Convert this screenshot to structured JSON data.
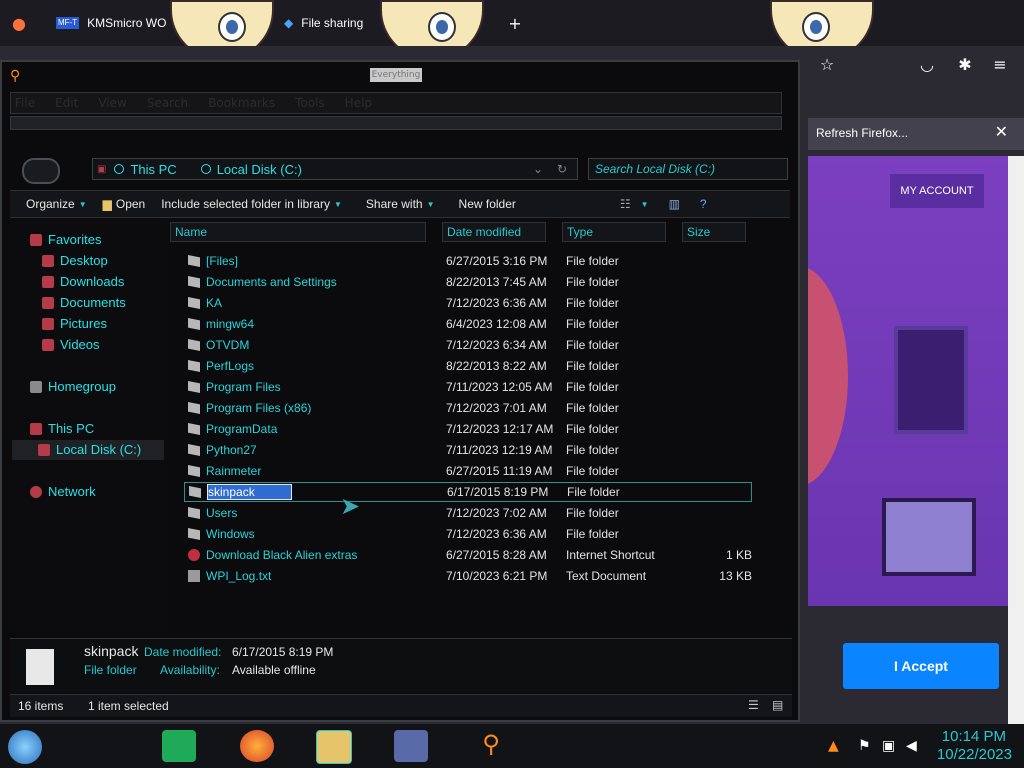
{
  "browser": {
    "tabs": [
      {
        "label": "KMSmicro WO",
        "icon": "MF-T"
      },
      {
        "label": "File sharing"
      }
    ],
    "new_tab": "+",
    "notification": {
      "text": "Refresh Firefox...",
      "close": "✕"
    },
    "page": {
      "my_account": "MY ACCOUNT",
      "accept": "I Accept"
    }
  },
  "explorer": {
    "top_search_label": "Everything",
    "menu": [
      "File",
      "Edit",
      "View",
      "Search",
      "Bookmarks",
      "Tools",
      "Help"
    ],
    "address": {
      "crumbs": [
        "This PC",
        "Local Disk (C:)"
      ]
    },
    "search_placeholder": "Search Local Disk (C:)",
    "toolbar": {
      "organize": "Organize",
      "open": "Open",
      "include": "Include selected folder in library",
      "share": "Share with",
      "new_folder": "New folder"
    },
    "nav": {
      "favorites": "Favorites",
      "desktop": "Desktop",
      "downloads": "Downloads",
      "documents": "Documents",
      "pictures": "Pictures",
      "videos": "Videos",
      "homegroup": "Homegroup",
      "this_pc": "This PC",
      "local_disk": "Local Disk (C:)",
      "network": "Network"
    },
    "columns": {
      "name": "Name",
      "date": "Date modified",
      "type": "Type",
      "size": "Size"
    },
    "files": [
      {
        "name": "[Files]",
        "date": "6/27/2015 3:16 PM",
        "type": "File folder",
        "size": ""
      },
      {
        "name": "Documents and Settings",
        "date": "8/22/2013 7:45 AM",
        "type": "File folder",
        "size": ""
      },
      {
        "name": "KA",
        "date": "7/12/2023 6:36 AM",
        "type": "File folder",
        "size": ""
      },
      {
        "name": "mingw64",
        "date": "6/4/2023 12:08 AM",
        "type": "File folder",
        "size": ""
      },
      {
        "name": "OTVDM",
        "date": "7/12/2023 6:34 AM",
        "type": "File folder",
        "size": ""
      },
      {
        "name": "PerfLogs",
        "date": "8/22/2013 8:22 AM",
        "type": "File folder",
        "size": ""
      },
      {
        "name": "Program Files",
        "date": "7/11/2023 12:05 AM",
        "type": "File folder",
        "size": ""
      },
      {
        "name": "Program Files (x86)",
        "date": "7/12/2023 7:01 AM",
        "type": "File folder",
        "size": ""
      },
      {
        "name": "ProgramData",
        "date": "7/12/2023 12:17 AM",
        "type": "File folder",
        "size": ""
      },
      {
        "name": "Python27",
        "date": "7/11/2023 12:19 AM",
        "type": "File folder",
        "size": ""
      },
      {
        "name": "Rainmeter",
        "date": "6/27/2015 11:19 AM",
        "type": "File folder",
        "size": ""
      },
      {
        "name": "skinpack",
        "date": "6/17/2015 8:19 PM",
        "type": "File folder",
        "size": ""
      },
      {
        "name": "Users",
        "date": "7/12/2023 7:02 AM",
        "type": "File folder",
        "size": ""
      },
      {
        "name": "Windows",
        "date": "7/12/2023 6:36 AM",
        "type": "File folder",
        "size": ""
      },
      {
        "name": "Download Black Alien extras",
        "date": "6/27/2015 8:28 AM",
        "type": "Internet Shortcut",
        "size": "1 KB"
      },
      {
        "name": "WPI_Log.txt",
        "date": "7/10/2023 6:21 PM",
        "type": "Text Document",
        "size": "13 KB"
      }
    ],
    "details": {
      "name": "skinpack",
      "date_label": "Date modified:",
      "date_value": "6/17/2015 8:19 PM",
      "type": "File folder",
      "avail_label": "Availability:",
      "avail_value": "Available offline"
    },
    "status": {
      "count": "16 items",
      "selected": "1 item selected"
    }
  },
  "taskbar": {
    "time": "10:14 PM",
    "date": "10/22/2023"
  }
}
